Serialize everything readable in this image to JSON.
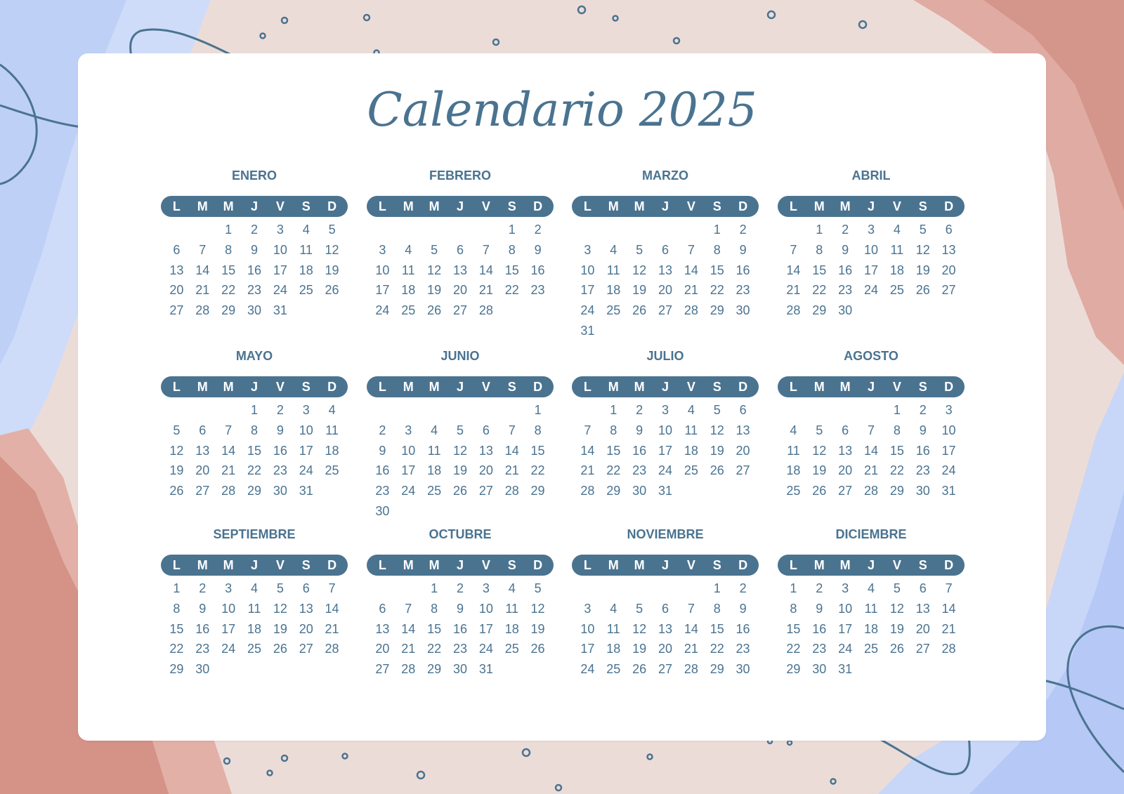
{
  "title": "Calendario 2025",
  "colors": {
    "accent": "#4a7390",
    "card": "#ffffff",
    "bg_pink": "#ecdcd8",
    "bg_blue": "#c9d6f7",
    "bg_red": "#d79a90"
  },
  "weekdays": [
    "L",
    "M",
    "M",
    "J",
    "V",
    "S",
    "D"
  ],
  "months": [
    {
      "name": "ENERO",
      "offset": 2,
      "days": 31
    },
    {
      "name": "FEBRERO",
      "offset": 5,
      "days": 28
    },
    {
      "name": "MARZO",
      "offset": 5,
      "days": 31
    },
    {
      "name": "ABRIL",
      "offset": 1,
      "days": 30
    },
    {
      "name": "MAYO",
      "offset": 3,
      "days": 31
    },
    {
      "name": "JUNIO",
      "offset": 6,
      "days": 30
    },
    {
      "name": "JULIO",
      "offset": 1,
      "days": 31
    },
    {
      "name": "AGOSTO",
      "offset": 4,
      "days": 31
    },
    {
      "name": "SEPTIEMBRE",
      "offset": 0,
      "days": 30
    },
    {
      "name": "OCTUBRE",
      "offset": 2,
      "days": 31
    },
    {
      "name": "NOVIEMBRE",
      "offset": 5,
      "days": 30
    },
    {
      "name": "DICIEMBRE",
      "offset": 0,
      "days": 31
    }
  ]
}
